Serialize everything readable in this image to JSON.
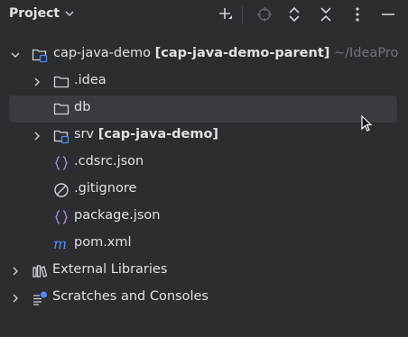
{
  "header": {
    "title": "Project",
    "icons": [
      "add-icon",
      "locate-icon",
      "expand-all-icon",
      "collapse-all-icon",
      "more-icon",
      "minimize-icon"
    ]
  },
  "tree": {
    "root": {
      "name": "cap-java-demo",
      "module": "[cap-java-demo-parent]",
      "path": "~/IdeaPro"
    },
    "idea": "idea",
    "db": "db",
    "srv": {
      "name": "srv",
      "module": "[cap-java-demo]"
    },
    "cdsrc": ".cdsrc.json",
    "gitignore": ".gitignore",
    "package": "package.json",
    "pom": "pom.xml",
    "external": "External Libraries",
    "scratches": "Scratches and Consoles"
  },
  "colors": {
    "background": "#2b2d30",
    "hover_row": "#393b40",
    "text": "#dfe1e5",
    "muted": "#6f737a",
    "maven_blue": "#548af7",
    "json_purple": "#a48ad9"
  }
}
